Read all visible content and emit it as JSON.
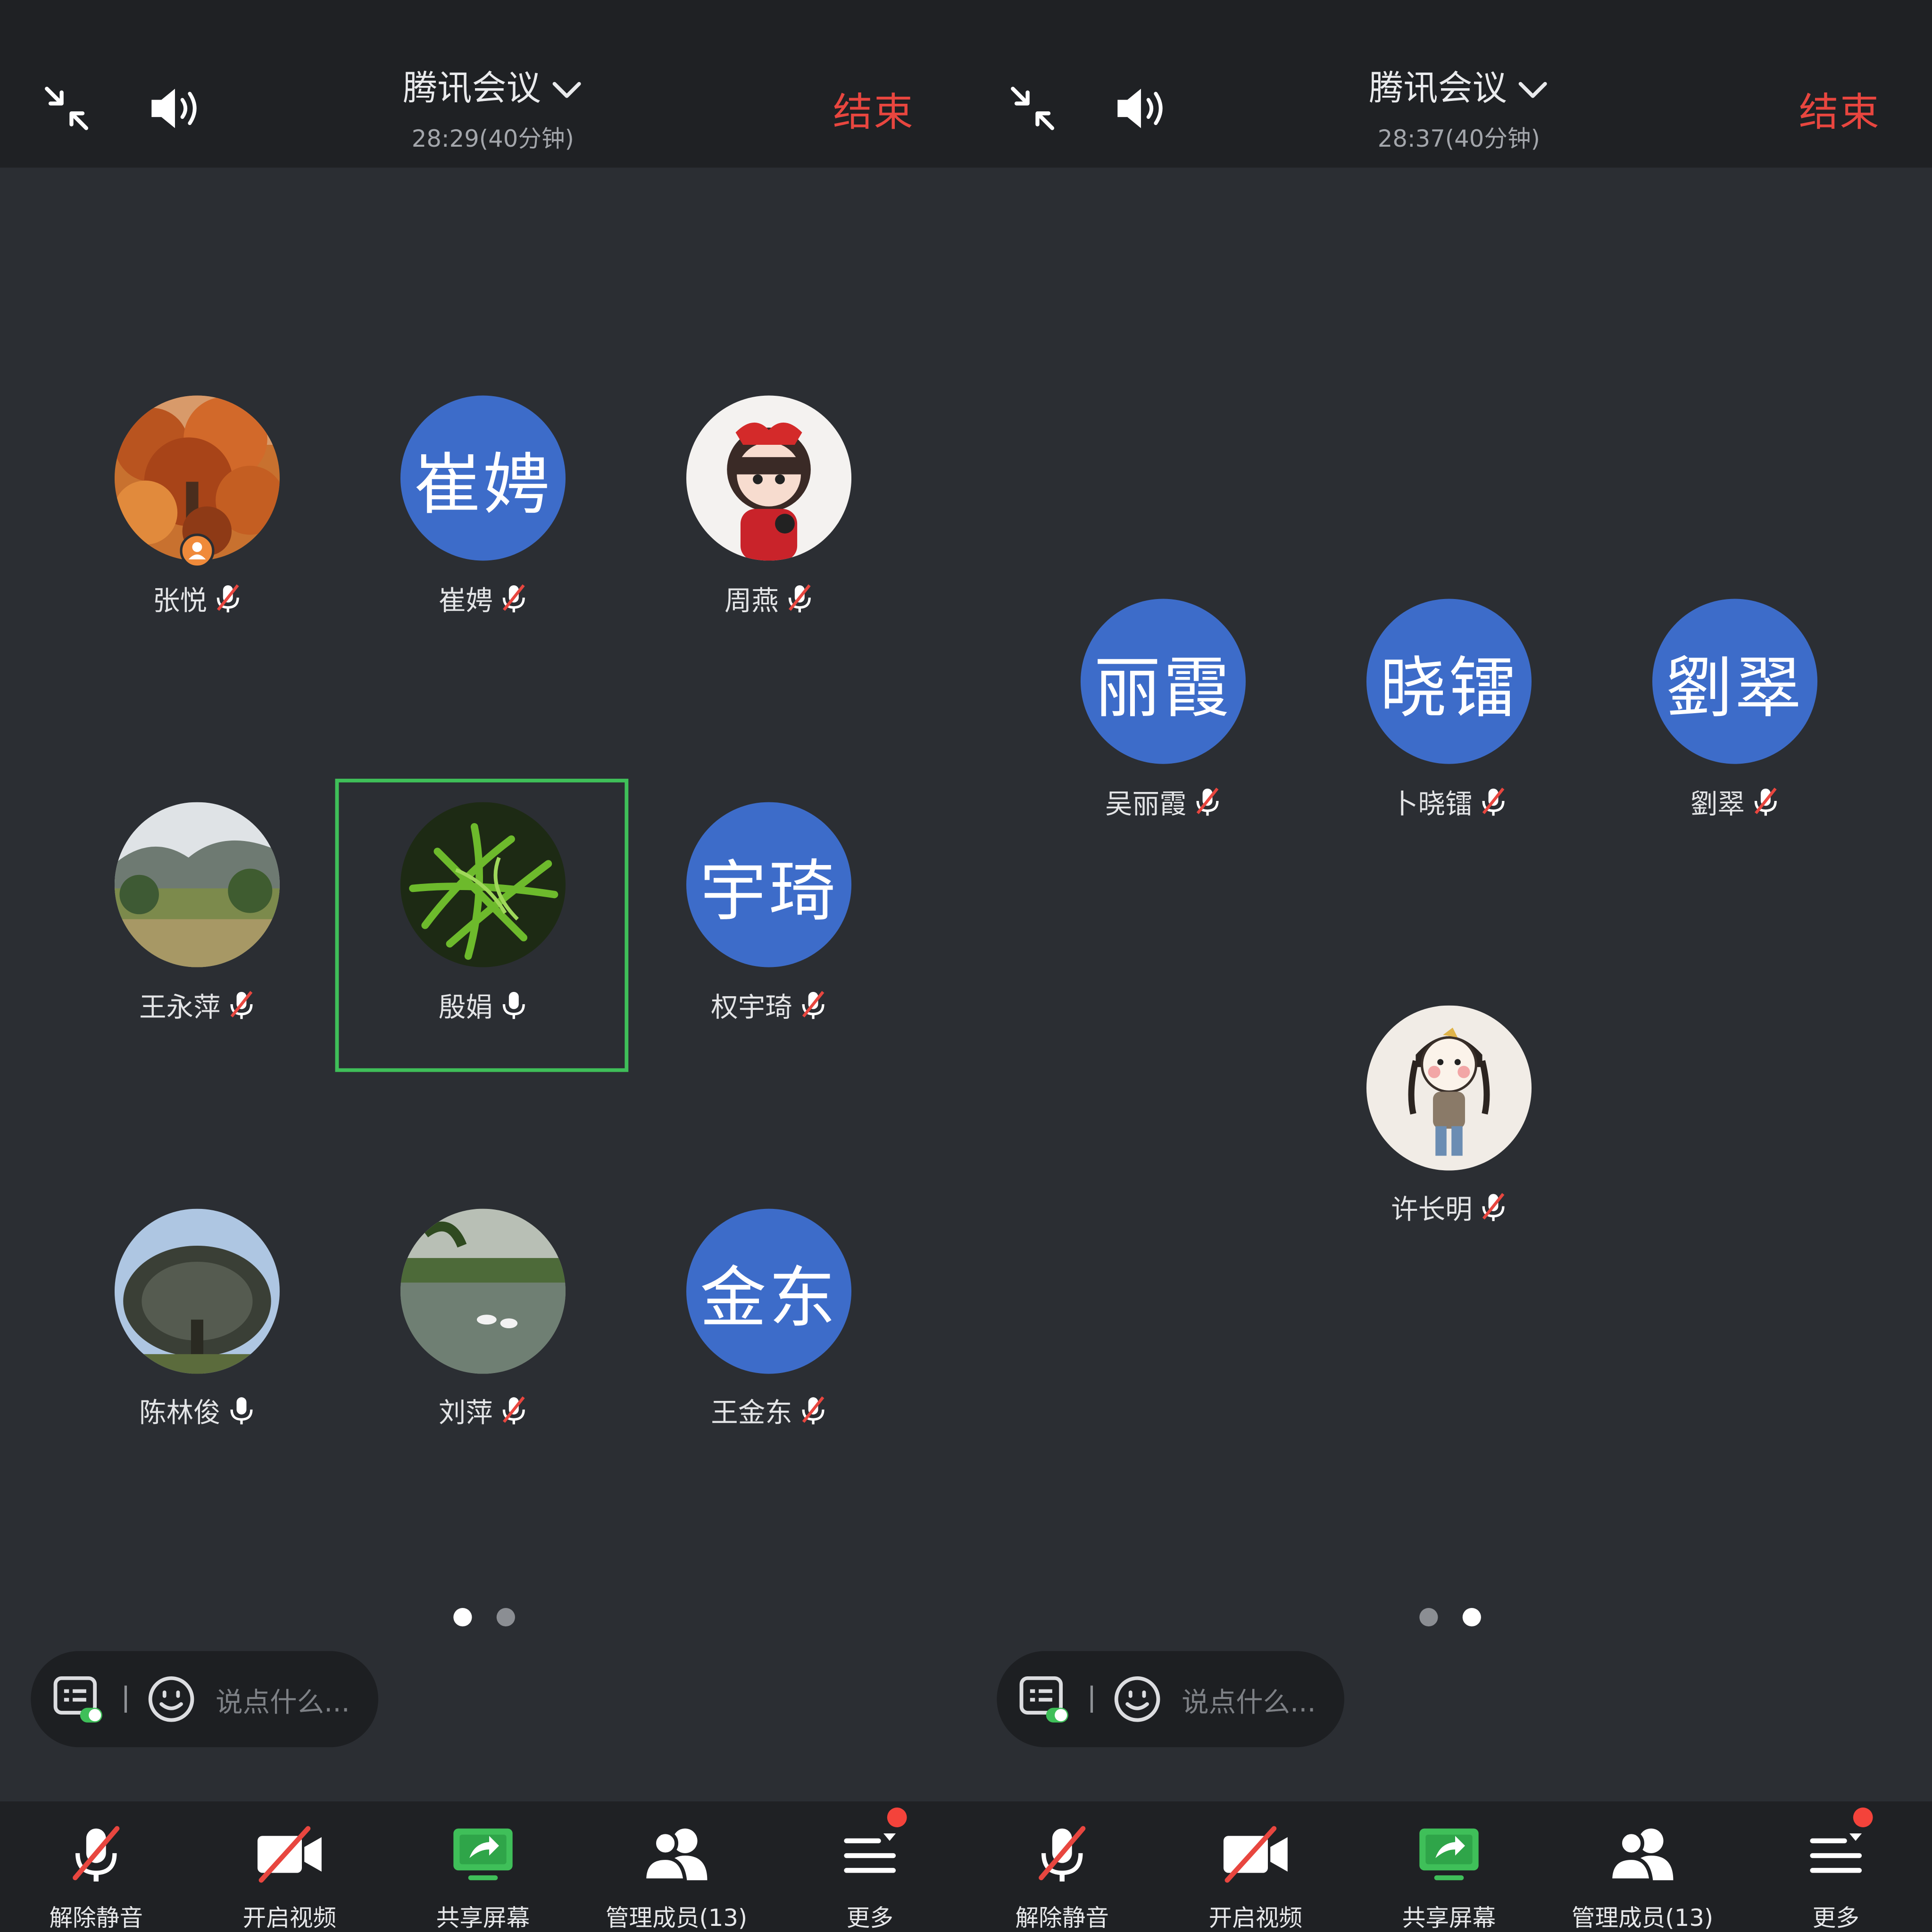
{
  "colors": {
    "end": "#e8463f",
    "avatar_bg": "#3d6cc9",
    "speaking_border": "#3fbf59",
    "badge": "#f4433b"
  },
  "left": {
    "header": {
      "title": "腾讯会议",
      "timer": "28:29(40分钟)",
      "end_label": "结束"
    },
    "participants": [
      {
        "name": "张悦",
        "mic": "muted",
        "avatar": "photo-autumn-tree",
        "host": true
      },
      {
        "name": "崔娉",
        "mic": "muted",
        "avatar_text": "崔娉"
      },
      {
        "name": "周燕",
        "mic": "muted",
        "avatar": "cartoon-girl-red-bow"
      },
      {
        "name": "王永萍",
        "mic": "muted",
        "avatar": "photo-mountain-meadow"
      },
      {
        "name": "殷娟",
        "mic": "on",
        "avatar": "photo-green-fern",
        "speaking": true
      },
      {
        "name": "权宇琦",
        "mic": "muted",
        "avatar_text": "宇琦"
      },
      {
        "name": "陈林俊",
        "mic": "on",
        "avatar": "photo-bare-tree"
      },
      {
        "name": "刘萍",
        "mic": "muted",
        "avatar": "photo-pond-swans"
      },
      {
        "name": "王金东",
        "mic": "muted",
        "avatar_text": "金东"
      }
    ],
    "page_indicator": {
      "pages": 2,
      "active": 1
    },
    "chat": {
      "placeholder": "说点什么..."
    },
    "toolbar": [
      {
        "label": "解除静音",
        "icon": "mic-muted-icon"
      },
      {
        "label": "开启视频",
        "icon": "video-off-icon"
      },
      {
        "label": "共享屏幕",
        "icon": "share-screen-icon"
      },
      {
        "label": "管理成员(13)",
        "icon": "members-icon"
      },
      {
        "label": "更多",
        "icon": "more-icon",
        "badge": true
      }
    ]
  },
  "right": {
    "header": {
      "title": "腾讯会议",
      "timer": "28:37(40分钟)",
      "end_label": "结束"
    },
    "participants": [
      {
        "name": "吴丽霞",
        "mic": "muted",
        "avatar_text": "丽霞"
      },
      {
        "name": "卜晓镭",
        "mic": "muted",
        "avatar_text": "晓镭"
      },
      {
        "name": "劉翠",
        "mic": "muted",
        "avatar_text": "劉翠"
      },
      {
        "name": "许长明",
        "mic": "muted",
        "avatar": "cartoon-girl-braids"
      }
    ],
    "page_indicator": {
      "pages": 2,
      "active": 2
    },
    "chat": {
      "placeholder": "说点什么..."
    },
    "toolbar": [
      {
        "label": "解除静音",
        "icon": "mic-muted-icon"
      },
      {
        "label": "开启视频",
        "icon": "video-off-icon"
      },
      {
        "label": "共享屏幕",
        "icon": "share-screen-icon"
      },
      {
        "label": "管理成员(13)",
        "icon": "members-icon"
      },
      {
        "label": "更多",
        "icon": "more-icon",
        "badge": true
      }
    ]
  }
}
